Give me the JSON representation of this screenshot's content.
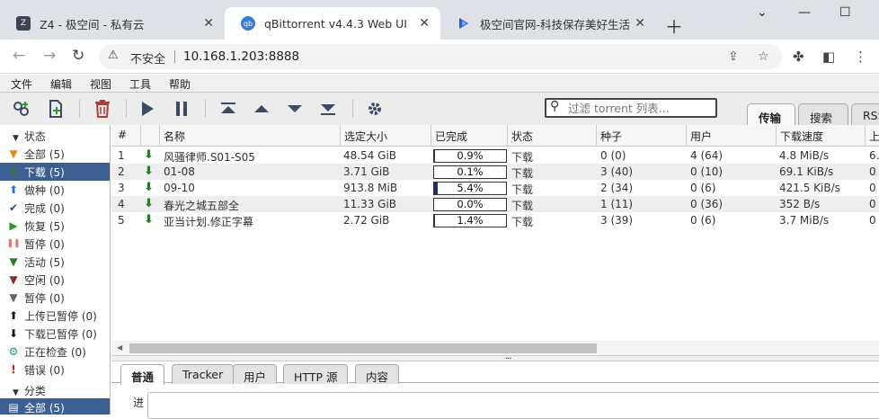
{
  "browser": {
    "tabs": [
      {
        "title": "Z4 - 极空间 - 私有云",
        "favicon": "z4-icon"
      },
      {
        "title": "qBittorrent v4.4.3 Web UI",
        "favicon": "qbittorrent-icon"
      },
      {
        "title": "极空间官网-科技保存美好生活",
        "favicon": "zspace-icon"
      }
    ],
    "security_label": "不安全",
    "url": "10.168.1.203:8888"
  },
  "menu": [
    "文件",
    "编辑",
    "视图",
    "工具",
    "帮助"
  ],
  "toolbar": {
    "filter_placeholder": "过滤 torrent 列表...",
    "view_tabs": [
      "传输",
      "搜索",
      "RSS"
    ]
  },
  "sidebar": {
    "status_header": "状态",
    "status_items": [
      {
        "label": "全部 (5)",
        "icon": "funnel-icon",
        "color": "#e08a1e"
      },
      {
        "label": "下载 (5)",
        "icon": "download-arrow-icon",
        "color": "#2c7a2c"
      },
      {
        "label": "做种 (0)",
        "icon": "upload-arrow-icon",
        "color": "#2a6fd6"
      },
      {
        "label": "完成 (0)",
        "icon": "checkmark-icon",
        "color": "#2a4a7a"
      },
      {
        "label": "恢复 (5)",
        "icon": "play-icon",
        "color": "#2c9a2c"
      },
      {
        "label": "暂停 (0)",
        "icon": "pause-icon",
        "color": "#e57373"
      },
      {
        "label": "活动 (5)",
        "icon": "funnel-green-icon",
        "color": "#2c7a2c"
      },
      {
        "label": "空闲 (0)",
        "icon": "funnel-red-icon",
        "color": "#8b2b2b"
      },
      {
        "label": "暂停 (0)",
        "icon": "funnel-gray-icon",
        "color": "#666666"
      },
      {
        "label": "上传已暂停 (0)",
        "icon": "upload-stalled-icon",
        "color": "#111111"
      },
      {
        "label": "下载已暂停 (0)",
        "icon": "download-stalled-icon",
        "color": "#111111"
      },
      {
        "label": "正在检查 (0)",
        "icon": "gear-check-icon",
        "color": "#1a9a8a"
      },
      {
        "label": "错误 (0)",
        "icon": "error-icon",
        "color": "#d11a1a"
      }
    ],
    "category_header": "分类",
    "category_items": [
      {
        "label": "全部 (5)"
      }
    ]
  },
  "table": {
    "headers": [
      "#",
      "名称",
      "选定大小",
      "已完成",
      "状态",
      "种子",
      "用户",
      "下载速度",
      "上"
    ],
    "rows": [
      {
        "num": "1",
        "name": "风骚律师.S01-S05",
        "size": "48.54 GiB",
        "progress": "0.9%",
        "progress_value": 0.009,
        "status": "下载",
        "seeds": "0 (0)",
        "peers": "4 (64)",
        "dl_speed": "4.8 MiB/s",
        "up": "6."
      },
      {
        "num": "2",
        "name": "01-08",
        "size": "3.71 GiB",
        "progress": "0.1%",
        "progress_value": 0.001,
        "status": "下载",
        "seeds": "3 (40)",
        "peers": "0 (10)",
        "dl_speed": "69.1 KiB/s",
        "up": "0"
      },
      {
        "num": "3",
        "name": "09-10",
        "size": "913.8 MiB",
        "progress": "5.4%",
        "progress_value": 0.054,
        "status": "下载",
        "seeds": "2 (34)",
        "peers": "0 (6)",
        "dl_speed": "421.5 KiB/s",
        "up": "0"
      },
      {
        "num": "4",
        "name": "春光之城五部全",
        "size": "11.33 GiB",
        "progress": "0.0%",
        "progress_value": 0.0,
        "status": "下载",
        "seeds": "1 (11)",
        "peers": "0 (36)",
        "dl_speed": "352 B/s",
        "up": "0"
      },
      {
        "num": "5",
        "name": "亚当计划.修正字幕",
        "size": "2.72 GiB",
        "progress": "1.4%",
        "progress_value": 0.014,
        "status": "下载",
        "seeds": "3 (39)",
        "peers": "0 (6)",
        "dl_speed": "3.7 MiB/s",
        "up": "0"
      }
    ]
  },
  "properties": {
    "tabs": [
      "普通",
      "Tracker",
      "用户",
      "HTTP 源",
      "内容"
    ],
    "partial_label": "进"
  }
}
